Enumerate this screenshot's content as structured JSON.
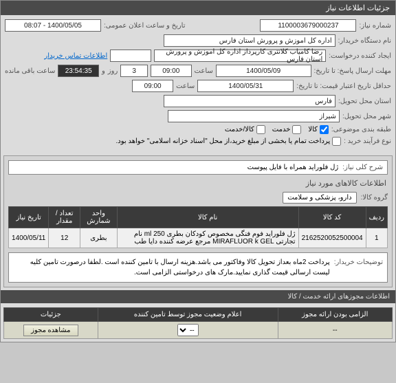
{
  "titlebar": "جزئیات اطلاعات نیاز",
  "labels": {
    "req_no": "شماره نیاز:",
    "pub_datetime": "تاریخ و ساعت اعلان عمومی:",
    "buyer_org": "نام دستگاه خریدار:",
    "creator": "ایجاد کننده درخواست:",
    "contact_link": "اطلاعات تماس خریدار",
    "reply_deadline": "مهلت ارسال پاسخ: تا تاریخ:",
    "hour": "ساعت",
    "and": "و",
    "day": "روز",
    "remain": "ساعت باقی مانده",
    "valid_from": "حداقل تاریخ اعتبار قیمت: تا تاریخ:",
    "province": "استان محل تحویل:",
    "city": "شهر محل تحویل:",
    "subject_cat": "طبقه بندی موضوعی:",
    "goods": "کالا",
    "service": "خدمت",
    "goods_service": "کالا/خدمت",
    "purchase_type": "نوع فرآیند خرید :",
    "purchase_note": "پرداخت تمام یا بخشی از مبلغ خرید،از محل \"اسناد خزانه اسلامی\" خواهد بود.",
    "desc_title": "شرح کلی نیاز:",
    "items_title": "اطلاعات کالاهای مورد نیاز",
    "group": "گروه کالا:",
    "buyer_notes": "توضیحات خریدار:",
    "footer": "اطلاعات مجوزهای ارائه خدمت / کالا"
  },
  "values": {
    "req_no": "1100003679000237",
    "pub_datetime": "1400/05/05 - 08:07",
    "buyer_org": "اداره کل اموزش و پرورش استان فارس",
    "creator": "رضا کامیاب کلانتری کارپرداز اداره کل اموزش و پرورش استان فارس",
    "reply_date": "1400/05/09",
    "reply_time": "09:00",
    "remain_days": "3",
    "remain_time": "23:54:35",
    "valid_date": "1400/05/31",
    "valid_time": "09:00",
    "province": "فارس",
    "city": "شیراز",
    "desc": "ژل فلوراید همراه با فایل پیوست",
    "group": "دارو، پزشکی و سلامت",
    "notes": "پرداخت 2ماه بعداز تحویل کالا وفاکتور می باشد.هزینه ارسال با تامین کننده است .لطفا درصورت تامین کلیه لیست ارسالی قیمت گذاری نمایید.مارک های درخواستی الزامی است."
  },
  "table": {
    "headers": [
      "ردیف",
      "کد کالا",
      "نام کالا",
      "واحد شمارش",
      "تعداد / مقدار",
      "تاریخ نیاز"
    ],
    "row": {
      "idx": "1",
      "code": "2162520052500004",
      "name": "ژل فلوراید فوم فنگی مخصوص کودکان بطری 250 ml نام تجارتی MIRAFLUOR k GEL مرجع عرضه کننده دایا طب",
      "unit": "بطری",
      "qty": "12",
      "date": "1400/05/11"
    }
  },
  "status": {
    "headers": [
      "الزامی بودن ارائه مجوز",
      "اعلام وضعیت مجوز توسط تامین کننده",
      "جزئیات"
    ],
    "val1": "--",
    "val2": "--",
    "btn": "مشاهده مجوز"
  }
}
